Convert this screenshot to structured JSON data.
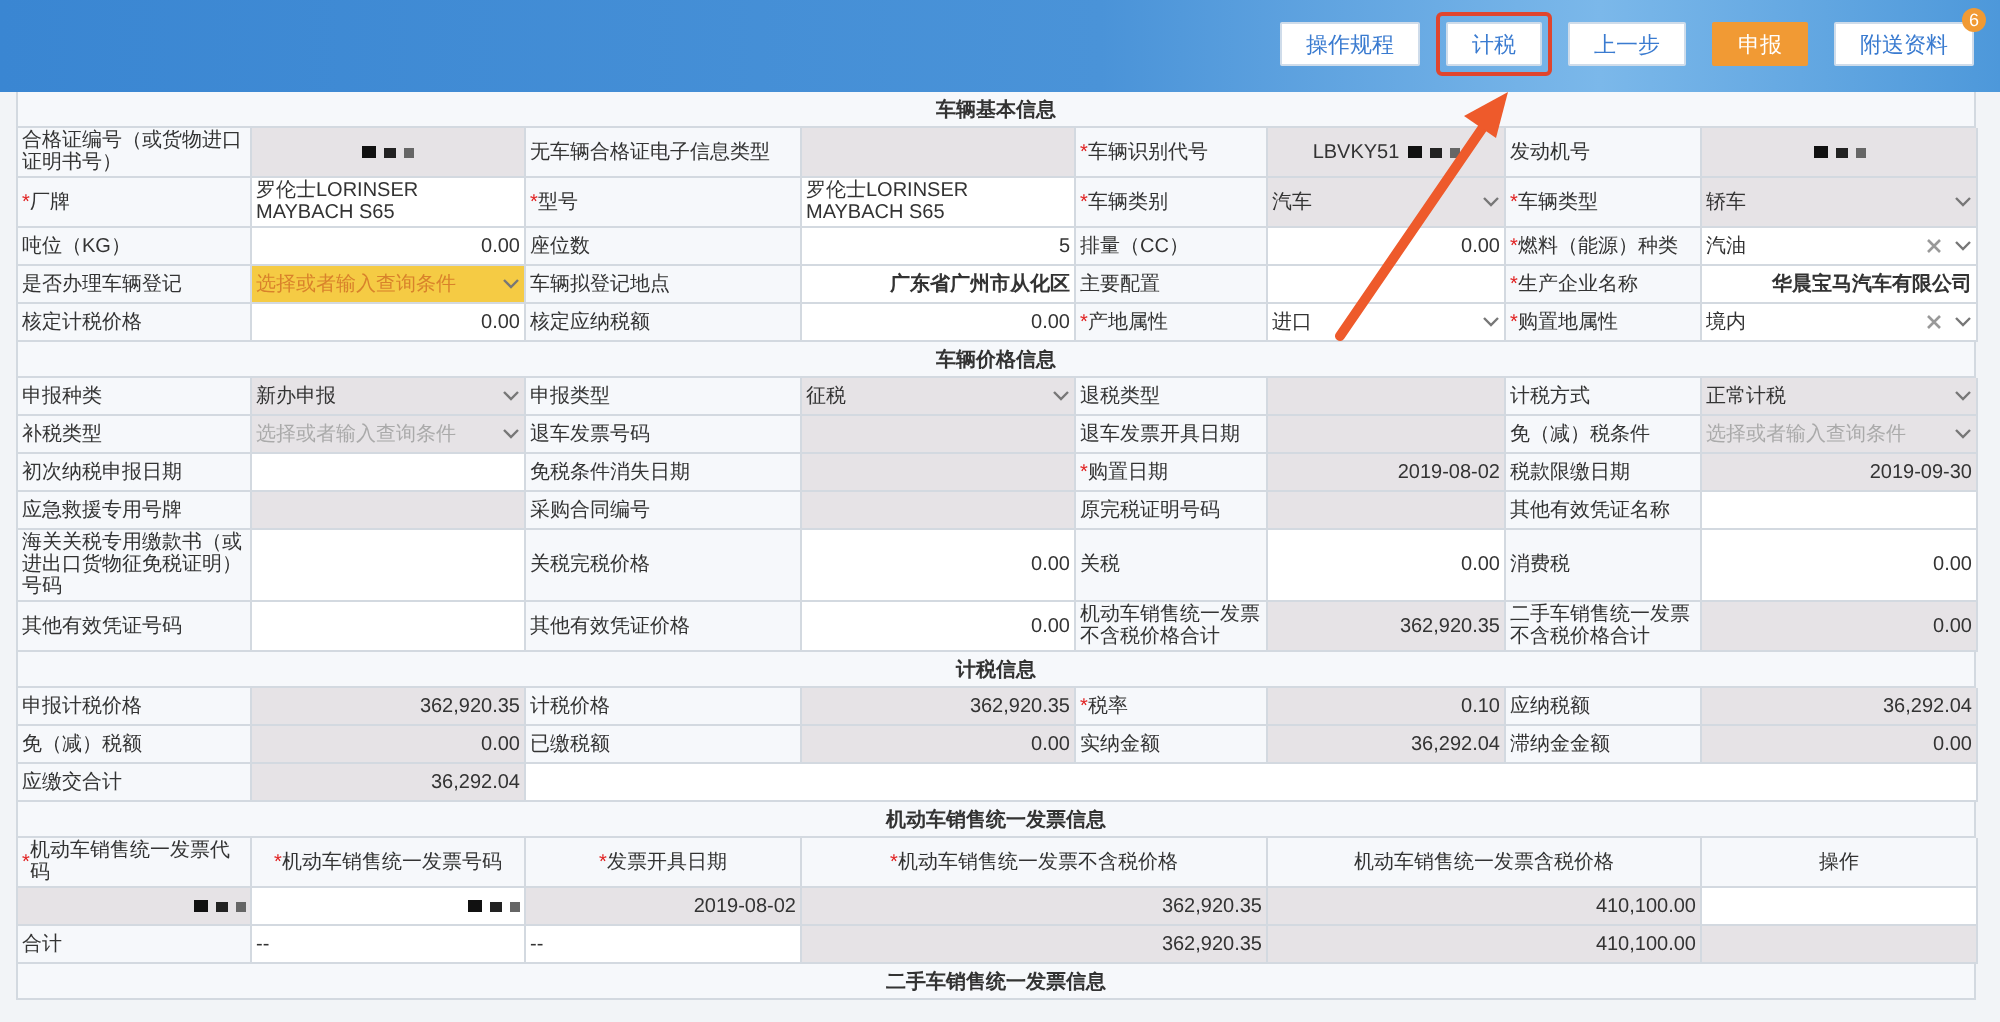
{
  "toolbar": {
    "buttons": [
      {
        "label": "操作规程",
        "kind": "normal",
        "highlighted": false
      },
      {
        "label": "计税",
        "kind": "normal",
        "highlighted": true
      },
      {
        "label": "上一步",
        "kind": "normal",
        "highlighted": false
      },
      {
        "label": "申报",
        "kind": "primary",
        "highlighted": false
      },
      {
        "label": "附送资料",
        "kind": "normal",
        "highlighted": false,
        "badge": "6"
      }
    ]
  },
  "sections": [
    {
      "title": "车辆基本信息",
      "rows": [
        {
          "cells": [
            {
              "kind": "label",
              "text": "合格证编号（或货物进口证明书号）"
            },
            {
              "kind": "code",
              "masked": true,
              "shaded": true
            },
            {
              "kind": "label",
              "text": "无车辆合格证电子信息类型"
            },
            {
              "kind": "empty",
              "shaded": true
            },
            {
              "kind": "label",
              "required_mark": "*",
              "text": "车辆识别代号"
            },
            {
              "kind": "code",
              "text": "LBVKY51",
              "masked": true,
              "shaded": true
            },
            {
              "kind": "label",
              "text": "发动机号"
            },
            {
              "kind": "code",
              "masked": true,
              "shaded": true
            }
          ]
        },
        {
          "cells": [
            {
              "kind": "label",
              "required_mark": "*",
              "text": "厂牌"
            },
            {
              "kind": "text",
              "text": "罗伦士LORINSER MAYBACH S65",
              "shaded": false
            },
            {
              "kind": "label",
              "required_mark": "*",
              "text": "型号"
            },
            {
              "kind": "text",
              "text": "罗伦士LORINSER MAYBACH S65",
              "shaded": false
            },
            {
              "kind": "label",
              "required_mark": "*",
              "text": "车辆类别"
            },
            {
              "kind": "select",
              "text": "汽车",
              "shaded": true
            },
            {
              "kind": "label",
              "required_mark": "*",
              "text": "车辆类型"
            },
            {
              "kind": "select",
              "text": "轿车",
              "shaded": true
            }
          ]
        },
        {
          "cells": [
            {
              "kind": "label",
              "text": "吨位（KG）"
            },
            {
              "kind": "figure",
              "text": "0.00",
              "shaded": false
            },
            {
              "kind": "label",
              "text": "座位数"
            },
            {
              "kind": "figure",
              "text": "5",
              "shaded": false
            },
            {
              "kind": "label",
              "text": "排量（CC）"
            },
            {
              "kind": "figure",
              "text": "0.00",
              "shaded": false
            },
            {
              "kind": "label",
              "required_mark": "*",
              "text": "燃料（能源）种类"
            },
            {
              "kind": "select",
              "text": "汽油",
              "clearable": true,
              "shaded": false
            }
          ]
        },
        {
          "cells": [
            {
              "kind": "label",
              "text": "是否办理车辆登记"
            },
            {
              "kind": "select",
              "placeholder": "选择或者输入查询条件",
              "highlighted": true,
              "shaded": false
            },
            {
              "kind": "label",
              "text": "车辆拟登记地点"
            },
            {
              "kind": "lookup",
              "text": "广东省广州市从化区",
              "shaded": false
            },
            {
              "kind": "label",
              "text": "主要配置"
            },
            {
              "kind": "empty",
              "shaded": false
            },
            {
              "kind": "label",
              "required_mark": "*",
              "text": "生产企业名称"
            },
            {
              "kind": "lookup",
              "text": "华晨宝马汽车有限公司",
              "shaded": false
            }
          ]
        },
        {
          "cells": [
            {
              "kind": "label",
              "text": "核定计税价格"
            },
            {
              "kind": "figure",
              "text": "0.00",
              "shaded": false
            },
            {
              "kind": "label",
              "text": "核定应纳税额"
            },
            {
              "kind": "figure",
              "text": "0.00",
              "shaded": false
            },
            {
              "kind": "label",
              "required_mark": "*",
              "text": "产地属性"
            },
            {
              "kind": "select",
              "text": "进口",
              "shaded": false
            },
            {
              "kind": "label",
              "required_mark": "*",
              "text": "购置地属性"
            },
            {
              "kind": "select",
              "text": "境内",
              "clearable": true,
              "shaded": false
            }
          ]
        }
      ]
    },
    {
      "title": "车辆价格信息",
      "rows": [
        {
          "cells": [
            {
              "kind": "label",
              "text": "申报种类"
            },
            {
              "kind": "select",
              "text": "新办申报",
              "shaded": true
            },
            {
              "kind": "label",
              "text": "申报类型"
            },
            {
              "kind": "select",
              "text": "征税",
              "shaded": true
            },
            {
              "kind": "label",
              "text": "退税类型"
            },
            {
              "kind": "empty",
              "shaded": true
            },
            {
              "kind": "label",
              "text": "计税方式"
            },
            {
              "kind": "select",
              "text": "正常计税",
              "shaded": true
            }
          ]
        },
        {
          "cells": [
            {
              "kind": "label",
              "text": "补税类型"
            },
            {
              "kind": "select",
              "placeholder": "选择或者输入查询条件",
              "shaded": true
            },
            {
              "kind": "label",
              "text": "退车发票号码"
            },
            {
              "kind": "empty",
              "shaded": true
            },
            {
              "kind": "label",
              "text": "退车发票开具日期"
            },
            {
              "kind": "empty",
              "shaded": true
            },
            {
              "kind": "label",
              "text": "免（减）税条件"
            },
            {
              "kind": "select",
              "placeholder": "选择或者输入查询条件",
              "shaded": true
            }
          ]
        },
        {
          "cells": [
            {
              "kind": "label",
              "text": "初次纳税申报日期"
            },
            {
              "kind": "empty",
              "shaded": false
            },
            {
              "kind": "label",
              "text": "免税条件消失日期"
            },
            {
              "kind": "empty",
              "shaded": true
            },
            {
              "kind": "label",
              "required_mark": "*",
              "text": "购置日期"
            },
            {
              "kind": "figure",
              "text": "2019-08-02",
              "shaded": true
            },
            {
              "kind": "label",
              "text": "税款限缴日期"
            },
            {
              "kind": "figure",
              "text": "2019-09-30",
              "shaded": true
            }
          ]
        },
        {
          "cells": [
            {
              "kind": "label",
              "text": "应急救援专用号牌"
            },
            {
              "kind": "empty",
              "shaded": true
            },
            {
              "kind": "label",
              "text": "采购合同编号"
            },
            {
              "kind": "empty",
              "shaded": true
            },
            {
              "kind": "label",
              "text": "原完税证明号码"
            },
            {
              "kind": "empty",
              "shaded": true
            },
            {
              "kind": "label",
              "text": "其他有效凭证名称"
            },
            {
              "kind": "empty",
              "shaded": false
            }
          ]
        },
        {
          "cells": [
            {
              "kind": "label",
              "text": "海关关税专用缴款书（或进出口货物征免税证明）号码"
            },
            {
              "kind": "empty",
              "shaded": false
            },
            {
              "kind": "label",
              "text": "关税完税价格"
            },
            {
              "kind": "figure",
              "text": "0.00",
              "shaded": false
            },
            {
              "kind": "label",
              "text": "关税"
            },
            {
              "kind": "figure",
              "text": "0.00",
              "shaded": false
            },
            {
              "kind": "label",
              "text": "消费税"
            },
            {
              "kind": "figure",
              "text": "0.00",
              "shaded": false
            }
          ]
        },
        {
          "cells": [
            {
              "kind": "label",
              "text": "其他有效凭证号码"
            },
            {
              "kind": "empty",
              "shaded": false
            },
            {
              "kind": "label",
              "text": "其他有效凭证价格"
            },
            {
              "kind": "figure",
              "text": "0.00",
              "shaded": false
            },
            {
              "kind": "label",
              "text": "机动车销售统一发票不含税价格合计"
            },
            {
              "kind": "figure",
              "text": "362,920.35",
              "shaded": true
            },
            {
              "kind": "label",
              "text": "二手车销售统一发票不含税价格合计"
            },
            {
              "kind": "figure",
              "text": "0.00",
              "shaded": true
            }
          ]
        }
      ]
    },
    {
      "title": "计税信息",
      "rows": [
        {
          "cells": [
            {
              "kind": "label",
              "text": "申报计税价格"
            },
            {
              "kind": "figure",
              "text": "362,920.35",
              "shaded": true
            },
            {
              "kind": "label",
              "text": "计税价格"
            },
            {
              "kind": "figure",
              "text": "362,920.35",
              "shaded": true
            },
            {
              "kind": "label",
              "required_mark": "*",
              "text": "税率"
            },
            {
              "kind": "figure",
              "text": "0.10",
              "shaded": true
            },
            {
              "kind": "label",
              "text": "应纳税额"
            },
            {
              "kind": "figure",
              "text": "36,292.04",
              "shaded": true
            }
          ]
        },
        {
          "cells": [
            {
              "kind": "label",
              "text": "免（减）税额"
            },
            {
              "kind": "figure",
              "text": "0.00",
              "shaded": true
            },
            {
              "kind": "label",
              "text": "已缴税额"
            },
            {
              "kind": "figure",
              "text": "0.00",
              "shaded": true
            },
            {
              "kind": "label",
              "text": "实纳金额"
            },
            {
              "kind": "figure",
              "text": "36,292.04",
              "shaded": true
            },
            {
              "kind": "label",
              "text": "滞纳金金额"
            },
            {
              "kind": "figure",
              "text": "0.00",
              "shaded": true
            }
          ]
        },
        {
          "cells": [
            {
              "kind": "label",
              "text": "应缴交合计"
            },
            {
              "kind": "figure",
              "text": "36,292.04",
              "shaded": true
            },
            {
              "kind": "filler"
            }
          ]
        }
      ]
    }
  ],
  "invoice": {
    "title": "机动车销售统一发票信息",
    "columns": [
      {
        "label": "机动车销售统一发票代码",
        "required_mark": "*"
      },
      {
        "label": "机动车销售统一发票号码",
        "required_mark": "*"
      },
      {
        "label": "发票开具日期",
        "required_mark": "*"
      },
      {
        "label": "机动车销售统一发票不含税价格",
        "required_mark": "*"
      },
      {
        "label": "机动车销售统一发票含税价格"
      },
      {
        "label": "操作"
      }
    ],
    "rows": [
      {
        "cells": [
          {
            "kind": "figure",
            "masked": true,
            "shaded": true
          },
          {
            "kind": "figure",
            "masked": true,
            "shaded": false
          },
          {
            "kind": "figure",
            "text": "2019-08-02",
            "shaded": true
          },
          {
            "kind": "figure",
            "text": "362,920.35",
            "shaded": true
          },
          {
            "kind": "figure",
            "text": "410,100.00",
            "shaded": true
          },
          {
            "kind": "empty",
            "shaded": false
          }
        ]
      },
      {
        "cells": [
          {
            "kind": "label",
            "text": "合计"
          },
          {
            "kind": "text",
            "text": "--",
            "shaded": false
          },
          {
            "kind": "text",
            "text": "--",
            "shaded": false
          },
          {
            "kind": "figure",
            "text": "362,920.35",
            "shaded": true
          },
          {
            "kind": "figure",
            "text": "410,100.00",
            "shaded": true
          },
          {
            "kind": "empty",
            "shaded": true
          }
        ]
      }
    ]
  },
  "next_section": {
    "title": "二手车销售统一发票信息"
  }
}
